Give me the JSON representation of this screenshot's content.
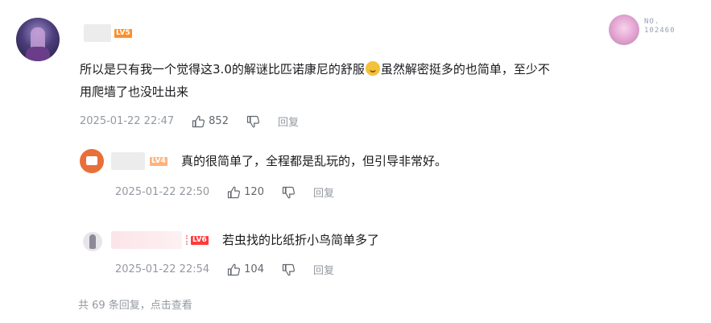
{
  "comment": {
    "level": "LV5",
    "text_line1": "所以是只有我一个觉得这3.0的解谜比匹诺康尼的舒服",
    "emoji": "laugh-emoji",
    "text_line1_rest": "虽然解密挺多的也简单，至少不",
    "text_line2": "用爬墙了也没吐出来",
    "time": "2025-01-22 22:47",
    "likes": "852",
    "reply_label": "回复",
    "badge_prefix": "NO.",
    "badge_number": "102460"
  },
  "replies": [
    {
      "level": "LV4",
      "text": "真的很简单了，全程都是乱玩的，但引导非常好。",
      "time": "2025-01-22 22:50",
      "likes": "120",
      "reply_label": "回复"
    },
    {
      "level": "LV6",
      "text": "若虫找的比纸折小鸟简单多了",
      "time": "2025-01-22 22:54",
      "likes": "104",
      "reply_label": "回复"
    }
  ],
  "footer": {
    "view_more": "共 69 条回复，点击查看"
  },
  "colors": {
    "lv4": "#ffb37c",
    "lv5": "#ff8e29",
    "lv6": "#ff3a3a",
    "meta": "#9499a0"
  }
}
